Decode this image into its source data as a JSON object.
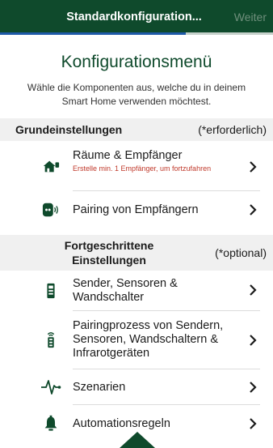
{
  "header": {
    "title": "Standardkonfiguration...",
    "next_label": "Weiter",
    "progress": 0.68
  },
  "main": {
    "heading": "Konfigurationsmenü",
    "subtitle": "Wähle die Komponenten aus, welche du in deinem Smart Home verwenden möchtest."
  },
  "sections": {
    "basic": {
      "title": "Grundeinstellungen",
      "note": "(*erforderlich)"
    },
    "advanced": {
      "title": "Fortgeschrittene Einstellungen",
      "note": "(*optional)"
    }
  },
  "items": {
    "rooms": {
      "label": "Räume & Empfänger",
      "hint": "Erstelle min. 1 Empfänger, um fortzufahren",
      "icon": "house-receiver-icon"
    },
    "pairing_receivers": {
      "label": "Pairing von Empfängern",
      "icon": "receiver-pairing-icon"
    },
    "senders": {
      "label": "Sender, Sensoren & Wandschalter",
      "icon": "remote-control-icon"
    },
    "pairing_senders": {
      "label": "Pairingprozess von Sendern, Sensoren, Wandschaltern & Infrarotgeräten",
      "icon": "remote-signal-icon"
    },
    "scenes": {
      "label": "Szenarien",
      "icon": "pulse-icon"
    },
    "rules": {
      "label": "Automationsregeln",
      "icon": "bell-icon"
    }
  },
  "colors": {
    "brand": "#0f4a2c",
    "accent": "#1e5aa8",
    "warning": "#c0392b"
  }
}
